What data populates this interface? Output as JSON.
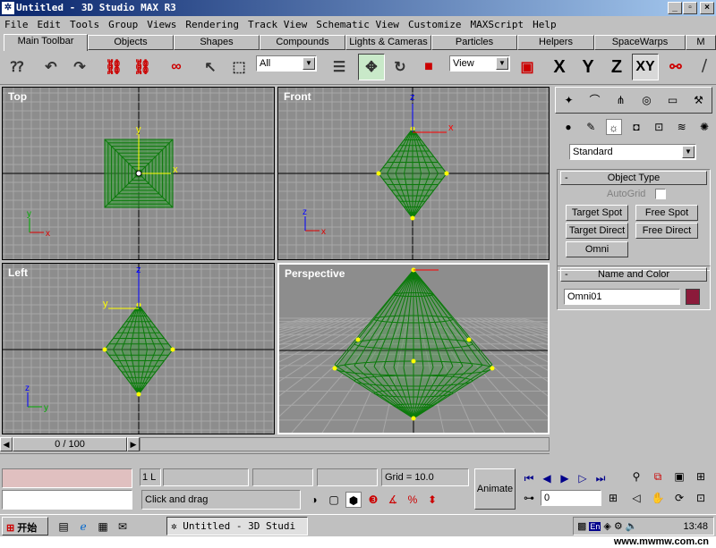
{
  "window": {
    "title": "Untitled - 3D Studio MAX R3",
    "min": "_",
    "max": "▫",
    "close": "×"
  },
  "menu": [
    "File",
    "Edit",
    "Tools",
    "Group",
    "Views",
    "Rendering",
    "Track View",
    "Schematic View",
    "Customize",
    "MAXScript",
    "Help"
  ],
  "tabs": [
    {
      "label": "Main Toolbar",
      "active": true
    },
    {
      "label": "Objects"
    },
    {
      "label": "Shapes"
    },
    {
      "label": "Compounds"
    },
    {
      "label": "Lights & Cameras"
    },
    {
      "label": "Particles"
    },
    {
      "label": "Helpers"
    },
    {
      "label": "SpaceWarps"
    },
    {
      "label": "M"
    }
  ],
  "toolbar": {
    "filter_value": "All",
    "coord_value": "View",
    "axis_x": "X",
    "axis_y": "Y",
    "axis_z": "Z",
    "axis_xy": "XY"
  },
  "viewports": {
    "top": "Top",
    "front": "Front",
    "left": "Left",
    "perspective": "Perspective"
  },
  "axes": {
    "x": "x",
    "y": "y",
    "z": "z"
  },
  "command_panel": {
    "category": "Standard",
    "object_type_title": "Object Type",
    "autogrid": "AutoGrid",
    "buttons": [
      "Target Spot",
      "Free Spot",
      "Target Direct",
      "Free Direct",
      "Omni"
    ],
    "name_color_title": "Name and Color",
    "name_value": "Omni01",
    "color": "#8b1a3a"
  },
  "timeline": {
    "frame": "0 / 100"
  },
  "status": {
    "prompt": "Click and drag",
    "lock": "1 L",
    "grid": "Grid = 10.0",
    "animate": "Animate",
    "frame_value": "0"
  },
  "taskbar": {
    "start": "开始",
    "task": "Untitled - 3D Studi",
    "clock": "13:48"
  },
  "footer": "www.mwmw.com.cn"
}
